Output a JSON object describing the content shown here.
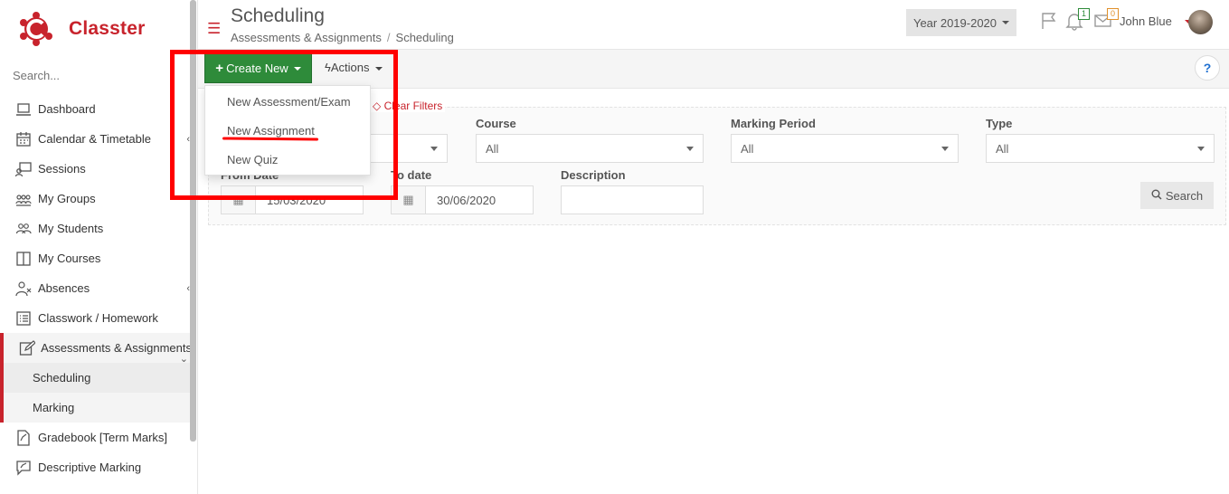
{
  "app": {
    "name": "Classter"
  },
  "sidebar": {
    "search_placeholder": "Search...",
    "items": [
      {
        "label": "Dashboard",
        "icon": "laptop-icon"
      },
      {
        "label": "Calendar & Timetable",
        "icon": "calendar-icon"
      },
      {
        "label": "Sessions",
        "icon": "presentation-icon"
      },
      {
        "label": "My Groups",
        "icon": "groups-icon"
      },
      {
        "label": "My Students",
        "icon": "students-icon"
      },
      {
        "label": "My Courses",
        "icon": "book-icon"
      },
      {
        "label": "Absences",
        "icon": "user-x-icon"
      },
      {
        "label": "Classwork / Homework",
        "icon": "list-icon"
      },
      {
        "label": "Assessments & Assignments",
        "icon": "edit-icon"
      },
      {
        "label": "Gradebook [Term Marks]",
        "icon": "document-icon"
      },
      {
        "label": "Descriptive Marking",
        "icon": "comment-icon"
      }
    ],
    "sub_items": [
      "Scheduling",
      "Marking"
    ]
  },
  "header": {
    "title": "Scheduling",
    "breadcrumb": [
      "Assessments & Assignments",
      "Scheduling"
    ],
    "year": "Year 2019-2020",
    "flag_icon": "flag-icon",
    "notifications_count": "1",
    "messages_count": "0",
    "user_name": "John Blue"
  },
  "toolbar": {
    "create_new_label": "Create New",
    "actions_label": "Actions",
    "help_label": "?"
  },
  "dropdown": {
    "items": [
      "New Assessment/Exam",
      "New Assignment",
      "New Quiz"
    ]
  },
  "filters": {
    "clear_label": "Clear Filters",
    "course_label": "Course",
    "course_value": "All",
    "marking_period_label": "Marking Period",
    "marking_period_value": "All",
    "type_label": "Type",
    "type_value": "All",
    "from_date_label": "From Date",
    "from_date_value": "15/03/2020",
    "to_date_label": "To date",
    "to_date_value": "30/06/2020",
    "description_label": "Description",
    "description_value": "",
    "search_label": "Search"
  },
  "colors": {
    "brand": "#c8232c",
    "create_button": "#2e8b3a",
    "annotation": "#ff0000"
  }
}
